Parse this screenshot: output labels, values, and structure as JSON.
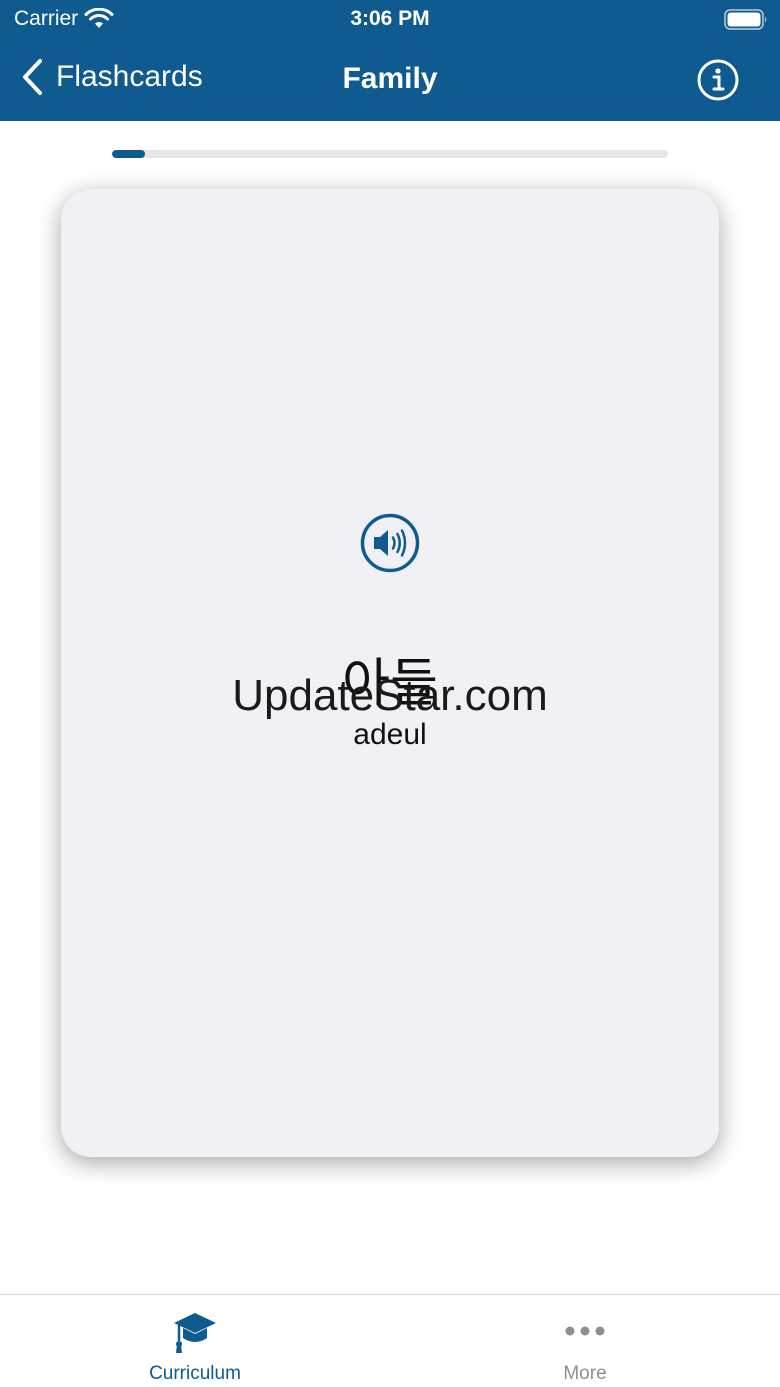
{
  "status_bar": {
    "carrier": "Carrier",
    "time": "3:06 PM"
  },
  "nav": {
    "back_label": "Flashcards",
    "title": "Family"
  },
  "progress": {
    "value": 0.06
  },
  "card": {
    "word": "아들",
    "romanization": "adeul"
  },
  "watermark": "UpdateStar.com",
  "tabs": [
    {
      "label": "Curriculum",
      "icon": "graduation-cap-icon",
      "selected": true
    },
    {
      "label": "More",
      "icon": "more-dots-icon",
      "selected": false
    }
  ],
  "colors": {
    "primary": "#0f5a8f",
    "card_background": "#f0f0f5",
    "inactive_tab": "#8e8e93"
  }
}
